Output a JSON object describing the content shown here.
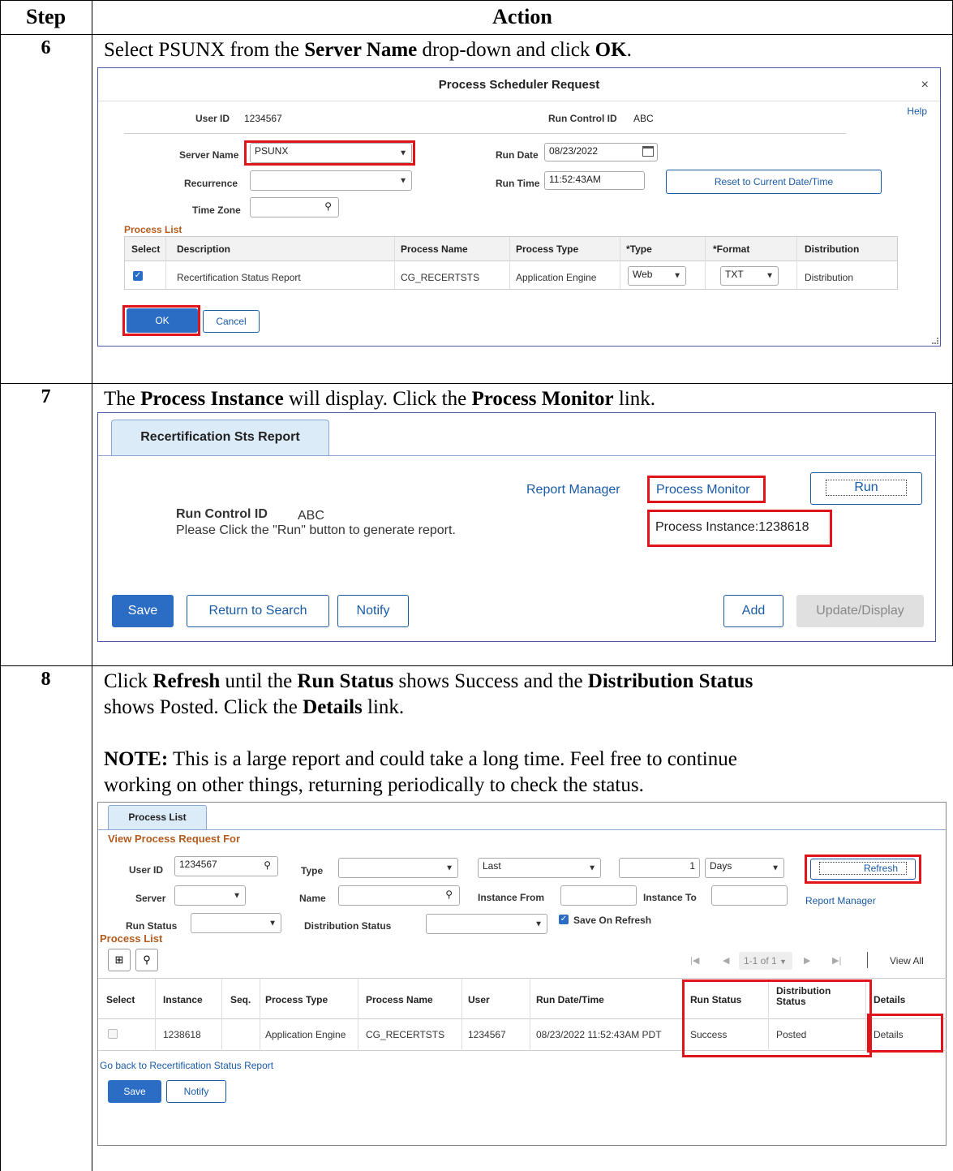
{
  "table": {
    "header_step": "Step",
    "header_action": "Action"
  },
  "step6": {
    "num": "6",
    "text_pre": "Select PSUNX from the ",
    "text_b1": "Server Name",
    "text_mid": " drop-down and click ",
    "text_b2": "OK",
    "text_end": ".",
    "dialog": {
      "title": "Process Scheduler Request",
      "close": "×",
      "help": "Help",
      "user_id_label": "User ID",
      "user_id_value": "1234567",
      "run_control_label": "Run Control ID",
      "run_control_value": "ABC",
      "server_name_label": "Server Name",
      "server_name_value": "PSUNX",
      "run_date_label": "Run Date",
      "run_date_value": "08/23/2022",
      "recurrence_label": "Recurrence",
      "recurrence_value": "",
      "run_time_label": "Run Time",
      "run_time_value": "11:52:43AM",
      "reset_button": "Reset to Current Date/Time",
      "time_zone_label": "Time Zone",
      "time_zone_value": "",
      "process_list_label": "Process List",
      "columns": {
        "select": "Select",
        "description": "Description",
        "process_name": "Process Name",
        "process_type": "Process Type",
        "type": "*Type",
        "format": "*Format",
        "distribution": "Distribution"
      },
      "row": {
        "description": "Recertification Status Report",
        "process_name": "CG_RECERTSTS",
        "process_type": "Application Engine",
        "type": "Web",
        "format": "TXT",
        "distribution": "Distribution"
      },
      "ok_button": "OK",
      "cancel_button": "Cancel"
    }
  },
  "step7": {
    "num": "7",
    "text_pre": "The ",
    "text_b1": "Process Instance",
    "text_mid": " will display. Click the ",
    "text_b2": "Process Monitor",
    "text_end": " link.",
    "panel": {
      "tab": "Recertification Sts Report",
      "run_control_label": "Run Control ID",
      "run_control_value": "ABC",
      "instruction": "Please Click the \"Run\" button to generate report.",
      "report_manager": "Report Manager",
      "process_monitor": "Process Monitor",
      "run_button": "Run",
      "process_instance": "Process Instance:1238618",
      "save": "Save",
      "return_to_search": "Return to Search",
      "notify": "Notify",
      "add": "Add",
      "update_display": "Update/Display"
    }
  },
  "step8": {
    "num": "8",
    "line1_a": "Click ",
    "line1_b1": "Refresh",
    "line1_c": " until the ",
    "line1_b2": "Run Status",
    "line1_d": " shows Success and the ",
    "line1_b3": "Distribution Status",
    "line2_a": "shows Posted. Click the ",
    "line2_b": "Details",
    "line2_c": " link.",
    "note_label": "NOTE:",
    "note_text1": " This is a large report and could take a long time. Feel free to continue",
    "note_text2": "working on other things, returning periodically to check the status.",
    "monitor": {
      "tab": "Process List",
      "view_for": "View Process Request For",
      "user_id_label": "User ID",
      "user_id_value": "1234567",
      "type_label": "Type",
      "type_value": "",
      "last_value": "Last",
      "days_count": "1",
      "days_value": "Days",
      "refresh_button": "Refresh",
      "server_label": "Server",
      "server_value": "",
      "name_label": "Name",
      "name_value": "",
      "instance_from_label": "Instance From",
      "instance_from_value": "",
      "instance_to_label": "Instance To",
      "instance_to_value": "",
      "report_manager": "Report Manager",
      "run_status_label": "Run Status",
      "run_status_value": "",
      "dist_status_label": "Distribution Status",
      "dist_status_value": "",
      "save_on_refresh": "Save On Refresh",
      "process_list_label": "Process List",
      "pager": "1-1 of 1",
      "view_all": "View All",
      "columns": {
        "select": "Select",
        "instance": "Instance",
        "seq": "Seq.",
        "process_type": "Process Type",
        "process_name": "Process Name",
        "user": "User",
        "run_datetime": "Run Date/Time",
        "run_status": "Run Status",
        "dist_status_1": "Distribution",
        "dist_status_2": "Status",
        "details": "Details"
      },
      "row": {
        "instance": "1238618",
        "seq": "",
        "process_type": "Application Engine",
        "process_name": "CG_RECERTSTS",
        "user": "1234567",
        "run_datetime": "08/23/2022 11:52:43AM PDT",
        "run_status": "Success",
        "dist_status": "Posted",
        "details": "Details"
      },
      "go_back": "Go back to Recertification Status Report",
      "save": "Save",
      "notify": "Notify"
    }
  }
}
